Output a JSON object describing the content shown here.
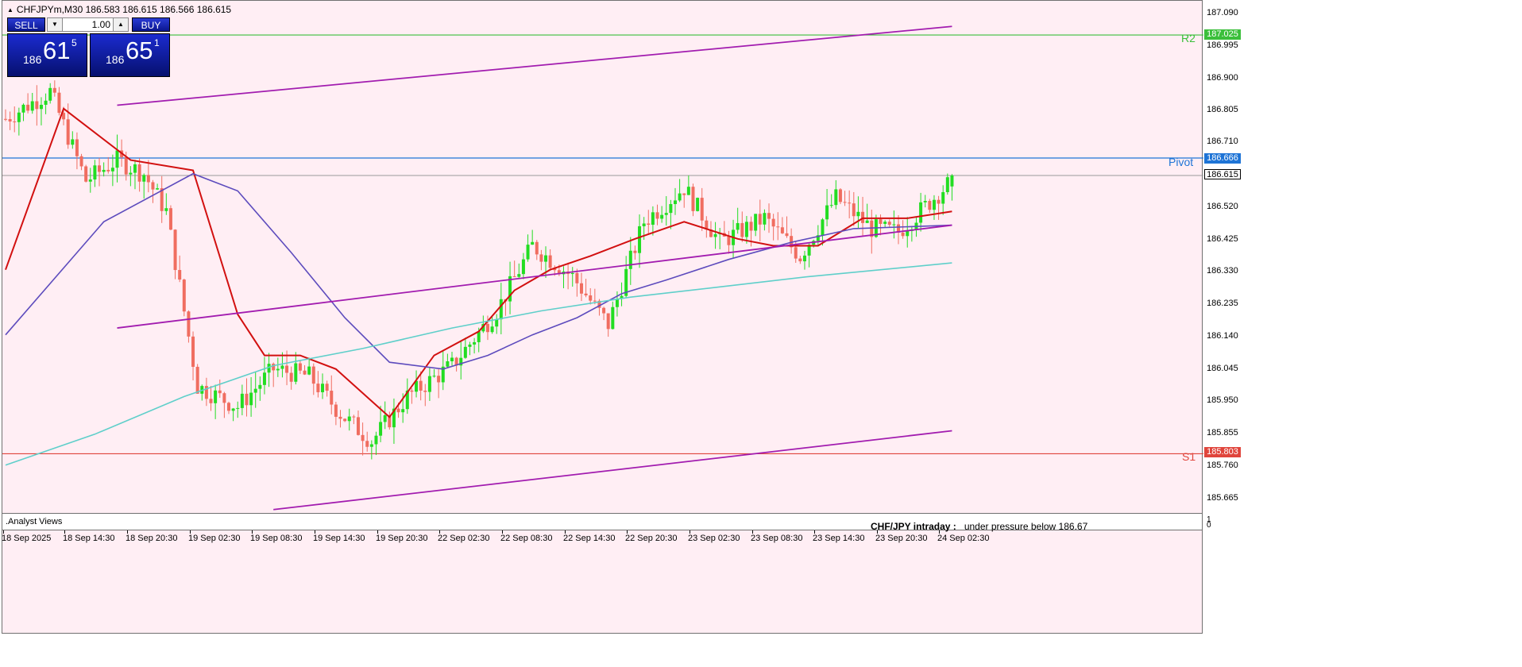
{
  "header": {
    "symbol_line": "CHFJPYm,M30  186.583 186.615 186.566 186.615"
  },
  "trade_panel": {
    "sell_label": "SELL",
    "buy_label": "BUY",
    "lot_value": "1.00",
    "sell_price": {
      "prefix": "186",
      "big": "61",
      "small": "5"
    },
    "buy_price": {
      "prefix": "186",
      "big": "65",
      "small": "1"
    }
  },
  "price_axis": {
    "labels": [
      "187.090",
      "186.995",
      "186.900",
      "186.805",
      "186.710",
      "186.520",
      "186.425",
      "186.330",
      "186.235",
      "186.140",
      "186.045",
      "185.950",
      "185.855",
      "185.760",
      "185.665"
    ]
  },
  "levels": [
    {
      "name": "R2",
      "value": "187.025",
      "color": "#3bbf3b"
    },
    {
      "name": "Pivot",
      "value": "186.666",
      "color": "#1e74d6"
    },
    {
      "name": "S1",
      "value": "185.803",
      "color": "#e0453c"
    }
  ],
  "current_price": {
    "value": "186.615"
  },
  "indicator_pane": {
    "label": ".Analyst Views",
    "note_title": "CHF/JPY intraday :",
    "note_text": "under pressure below 186.67",
    "scale_top": "1",
    "scale_bottom": "0"
  },
  "time_axis": {
    "labels": [
      "18 Sep 2025",
      "18 Sep 14:30",
      "18 Sep 20:30",
      "19 Sep 02:30",
      "19 Sep 08:30",
      "19 Sep 14:30",
      "19 Sep 20:30",
      "22 Sep 02:30",
      "22 Sep 08:30",
      "22 Sep 14:30",
      "22 Sep 20:30",
      "23 Sep 02:30",
      "23 Sep 08:30",
      "23 Sep 14:30",
      "23 Sep 20:30",
      "24 Sep 02:30"
    ]
  },
  "colors": {
    "background": "#ffeef4",
    "bull_candle": "#22dd22",
    "bear_candle": "#f06d60",
    "ma_fast": "#d21010",
    "ma_mid": "#5d4bbd",
    "ma_slow": "#5fcfca",
    "channel": "#a21caf"
  },
  "chart_data": {
    "type": "candlestick",
    "symbol": "CHFJPYm",
    "timeframe": "M30",
    "ylim": [
      185.62,
      187.12
    ],
    "x_labels": [
      "18 Sep 2025",
      "18 Sep 14:30",
      "18 Sep 20:30",
      "19 Sep 02:30",
      "19 Sep 08:30",
      "19 Sep 14:30",
      "19 Sep 20:30",
      "22 Sep 02:30",
      "22 Sep 08:30",
      "22 Sep 14:30",
      "22 Sep 20:30",
      "23 Sep 02:30",
      "23 Sep 08:30",
      "23 Sep 14:30",
      "23 Sep 20:30",
      "24 Sep 02:30"
    ],
    "y_ticks": [
      187.09,
      186.995,
      186.9,
      186.805,
      186.71,
      186.52,
      186.425,
      186.33,
      186.235,
      186.14,
      186.045,
      185.95,
      185.855,
      185.76,
      185.665
    ],
    "close_path": [
      [
        0,
        186.78
      ],
      [
        10,
        186.86
      ],
      [
        18,
        186.6
      ],
      [
        25,
        186.66
      ],
      [
        31,
        186.62
      ],
      [
        36,
        186.51
      ],
      [
        43,
        186.0
      ],
      [
        52,
        185.94
      ],
      [
        60,
        186.05
      ],
      [
        68,
        186.03
      ],
      [
        75,
        185.92
      ],
      [
        82,
        185.84
      ],
      [
        90,
        185.97
      ],
      [
        100,
        186.06
      ],
      [
        110,
        186.22
      ],
      [
        118,
        186.41
      ],
      [
        127,
        186.32
      ],
      [
        135,
        186.18
      ],
      [
        143,
        186.48
      ],
      [
        152,
        186.58
      ],
      [
        160,
        186.42
      ],
      [
        170,
        186.49
      ],
      [
        178,
        186.38
      ],
      [
        186,
        186.55
      ],
      [
        194,
        186.46
      ],
      [
        200,
        186.45
      ],
      [
        212,
        186.6
      ]
    ],
    "horizontal_levels": [
      {
        "name": "R2",
        "value": 187.025
      },
      {
        "name": "Pivot",
        "value": 186.666
      },
      {
        "name": "S1",
        "value": 185.803
      }
    ],
    "current_price": 186.615,
    "bar_high_low_ohlc_last": {
      "open": 186.583,
      "high": 186.615,
      "low": 186.566,
      "close": 186.615
    },
    "moving_averages": [
      {
        "color": "#d21010",
        "points": [
          [
            0,
            186.34
          ],
          [
            13,
            186.81
          ],
          [
            28,
            186.66
          ],
          [
            42,
            186.63
          ],
          [
            52,
            186.21
          ],
          [
            58,
            186.09
          ],
          [
            66,
            186.09
          ],
          [
            74,
            186.05
          ],
          [
            86,
            185.91
          ],
          [
            96,
            186.09
          ],
          [
            106,
            186.16
          ],
          [
            114,
            186.28
          ],
          [
            122,
            186.34
          ],
          [
            131,
            186.38
          ],
          [
            141,
            186.43
          ],
          [
            152,
            186.48
          ],
          [
            164,
            186.43
          ],
          [
            172,
            186.41
          ],
          [
            182,
            186.41
          ],
          [
            192,
            186.49
          ],
          [
            202,
            186.49
          ],
          [
            212,
            186.51
          ]
        ]
      },
      {
        "color": "#5d4bbd",
        "points": [
          [
            0,
            186.15
          ],
          [
            22,
            186.48
          ],
          [
            42,
            186.62
          ],
          [
            52,
            186.57
          ],
          [
            64,
            186.39
          ],
          [
            76,
            186.2
          ],
          [
            86,
            186.07
          ],
          [
            98,
            186.05
          ],
          [
            108,
            186.09
          ],
          [
            118,
            186.15
          ],
          [
            128,
            186.2
          ],
          [
            138,
            186.27
          ],
          [
            148,
            186.31
          ],
          [
            162,
            186.37
          ],
          [
            176,
            186.42
          ],
          [
            190,
            186.46
          ],
          [
            212,
            186.47
          ]
        ]
      },
      {
        "color": "#5fcfca",
        "points": [
          [
            0,
            185.77
          ],
          [
            20,
            185.86
          ],
          [
            40,
            185.97
          ],
          [
            60,
            186.06
          ],
          [
            80,
            186.11
          ],
          [
            100,
            186.17
          ],
          [
            120,
            186.22
          ],
          [
            140,
            186.26
          ],
          [
            160,
            186.29
          ],
          [
            180,
            186.32
          ],
          [
            212,
            186.36
          ]
        ]
      }
    ],
    "channel_lines": [
      {
        "from": [
          25,
          186.82
        ],
        "to": [
          212,
          187.05
        ]
      },
      {
        "from": [
          25,
          186.17
        ],
        "to": [
          212,
          186.47
        ]
      },
      {
        "from": [
          60,
          185.64
        ],
        "to": [
          212,
          185.87
        ]
      }
    ],
    "bar_count": 213
  }
}
